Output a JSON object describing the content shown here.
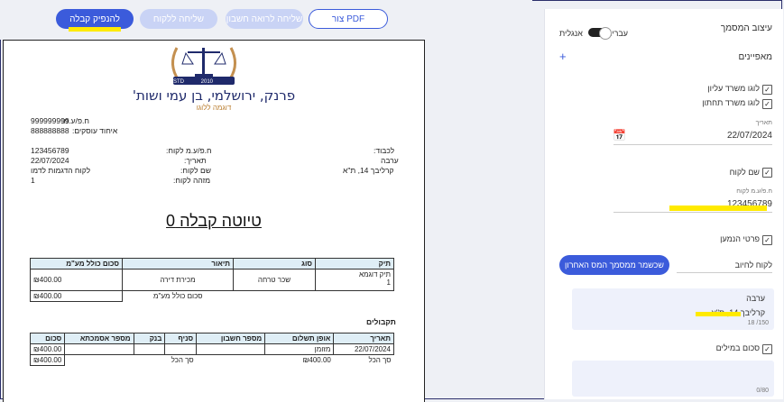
{
  "toolbar": {
    "make_receipt": "להנפיק קבלה",
    "send_to_client": "שליחה ללקוח",
    "send_to_accountant": "שליחה לרואה חשבון",
    "create_pdf": "צור PDF"
  },
  "document": {
    "logo": {
      "estd": "ESTD",
      "year": "2010"
    },
    "company_name": "פרנק, ירושלמי, בן עמי ושות'",
    "tagline": "דוגמה ללוגו",
    "business_id_label": "ח.פ/ע.מ:",
    "business_id": "999999999",
    "dealer_label": "איחוד עוסקים:",
    "dealer_id": "888888888",
    "to_label": "לכבוד:",
    "to_city": "ערבה",
    "to_address": "קרליבך 14, ת\"א",
    "client_id_label": "ח.פ/ע.מ לקוח:",
    "client_id": "123456789",
    "date_label": "תאריך:",
    "date": "22/07/2024",
    "client_name_label": "שם לקוח:",
    "client_name": "לקוח הדגמות לדמו",
    "client_ref_label": "מזהה לקוח:",
    "client_ref": "1",
    "title": "טיוטה קבלה 0",
    "items_headers": [
      "תיק",
      "סוג",
      "תיאור",
      "סכום כולל מע\"מ"
    ],
    "items": [
      {
        "case": "תיק דוגמא",
        "case_no": "1",
        "type": "שכר טרחה",
        "desc": "מכירת דירה",
        "amount": "₪400.00"
      }
    ],
    "total_label": "סכום כולל מע\"מ",
    "total": "₪400.00",
    "receipts_title": "תקבולים",
    "pay_headers": [
      "תאריך",
      "אופן תשלום",
      "מספר חשבון",
      "סניף",
      "בנק",
      "מספר אסמכתא",
      "סכום"
    ],
    "payments": [
      {
        "date": "22/07/2024",
        "method": "מזומן",
        "account": "",
        "branch": "",
        "bank": "",
        "ref": "",
        "amount": "₪400.00"
      }
    ],
    "sum_label": "סך הכל",
    "sum_amount": "₪400.00",
    "sum_label2": "סך הכל",
    "sum_amount2": "₪400.00"
  },
  "panel": {
    "title": "עיצוב המסמך",
    "lang_hebrew": "עברית",
    "lang_english": "אנגלית",
    "properties": "מאפיינים",
    "add": "+",
    "top_logo": "לוגו משרד עליון",
    "bottom_logo": "לוגו משרד תחתון",
    "date_label": "תאריך",
    "date_value": "22/07/2024",
    "client_name": "שם לקוח",
    "client_id_label": "ח.פ/ע.מ לקוח",
    "client_id_value": "123456789",
    "recipient_details": "פרטי הנמען",
    "charge_client": "לקוח לחיוב",
    "remember_btn": "שכשמר ממסמך המס האחרון",
    "address_line1": "ערבה",
    "address_line2": "קרליבך 14, ת\"א",
    "address_count": "150/ 18",
    "amount_words": "סכום במילים",
    "words_count": "0/80"
  }
}
